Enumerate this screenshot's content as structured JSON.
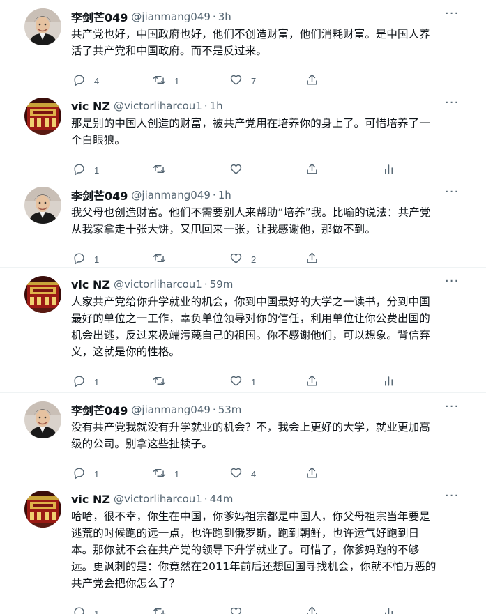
{
  "tweets": [
    {
      "name": "李剑芒049",
      "handle": "@jianmang049",
      "time": "3h",
      "avatar": "portrait-avatar",
      "lines": [
        "共产党也好，中国政府也好，他们不创造财富，他们消耗财富。是中国人养",
        "活了共产党和中国政府。而不是反过来。"
      ],
      "replies": "4",
      "retweets": "1",
      "likes": "7",
      "has_analytics": false
    },
    {
      "name": "vic NZ",
      "handle": "@victorliharcou1",
      "time": "1h",
      "avatar": "red-building-avatar",
      "lines": [
        "那是别的中国人创造的财富，被共产党用在培养你的身上了。可惜培养了一",
        "个白眼狼。"
      ],
      "replies": "1",
      "retweets": "",
      "likes": "",
      "has_analytics": true
    },
    {
      "name": "李剑芒049",
      "handle": "@jianmang049",
      "time": "1h",
      "avatar": "portrait-avatar",
      "lines": [
        "我父母也创造财富。他们不需要别人来帮助“培养”我。比喻的说法：共产党",
        "从我家拿走十张大饼，又甩回来一张，让我感谢他，那做不到。"
      ],
      "replies": "1",
      "retweets": "",
      "likes": "2",
      "has_analytics": false
    },
    {
      "name": "vic NZ",
      "handle": "@victorliharcou1",
      "time": "59m",
      "avatar": "red-building-avatar",
      "lines": [
        "人家共产党给你升学就业的机会，你到中国最好的大学之一读书，分到中国",
        "最好的单位之一工作，辜负单位领导对你的信任，利用单位让你公费出国的",
        "机会出逃，反过来极端污蔑自己的祖国。你不感谢他们，可以想象。背信弃",
        "义，这就是你的性格。"
      ],
      "replies": "1",
      "retweets": "",
      "likes": "1",
      "has_analytics": true
    },
    {
      "name": "李剑芒049",
      "handle": "@jianmang049",
      "time": "53m",
      "avatar": "portrait-avatar",
      "lines": [
        "没有共产党我就没有升学就业的机会？不，我会上更好的大学，就业更加高",
        "级的公司。别拿这些扯犊子。"
      ],
      "replies": "1",
      "retweets": "1",
      "likes": "4",
      "has_analytics": false
    },
    {
      "name": "vic NZ",
      "handle": "@victorliharcou1",
      "time": "44m",
      "avatar": "red-building-avatar",
      "lines": [
        "哈哈，很不幸，你生在中国，你爹妈祖宗都是中国人，你父母祖宗当年要是",
        "逃荒的时候跑的远一点，也许跑到俄罗斯，跑到朝鲜，也许运气好跑到日",
        "本。那你就不会在共产党的领导下升学就业了。可惜了，你爹妈跑的不够",
        "远。更讽刺的是：你竟然在2011年前后还想回国寻找机会，你就不怕万恶的",
        "共产党会把你怎么了？"
      ],
      "replies": "1",
      "retweets": "",
      "likes": "",
      "has_analytics": true
    }
  ]
}
